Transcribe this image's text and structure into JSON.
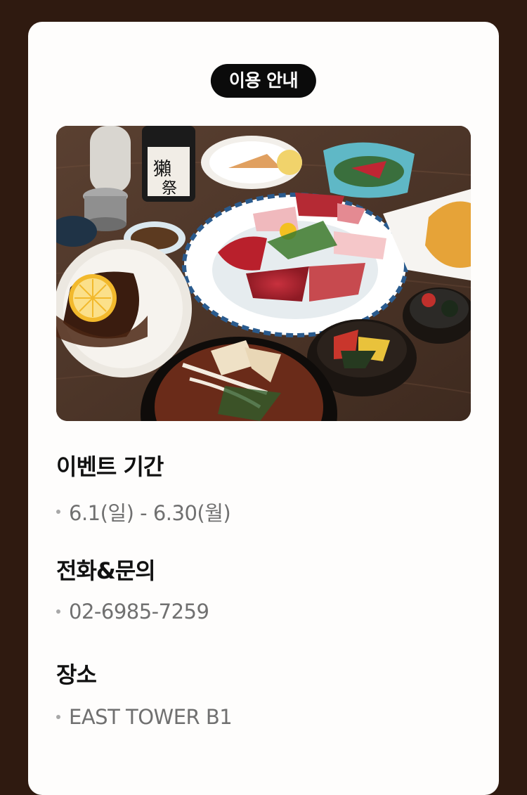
{
  "badge": {
    "label": "이용 안내"
  },
  "photo": {
    "alt": ""
  },
  "sections": [
    {
      "title": "이벤트 기간",
      "value": "6.1(일) - 6.30(월)"
    },
    {
      "title": "전화&문의",
      "value": "02-6985-7259"
    },
    {
      "title": "장소",
      "value": "EAST TOWER B1"
    }
  ],
  "colors": {
    "background": "#2f1a10",
    "card": "#fefdfc",
    "badge": "#0b0b0b",
    "title": "#111111",
    "value": "#707070"
  }
}
